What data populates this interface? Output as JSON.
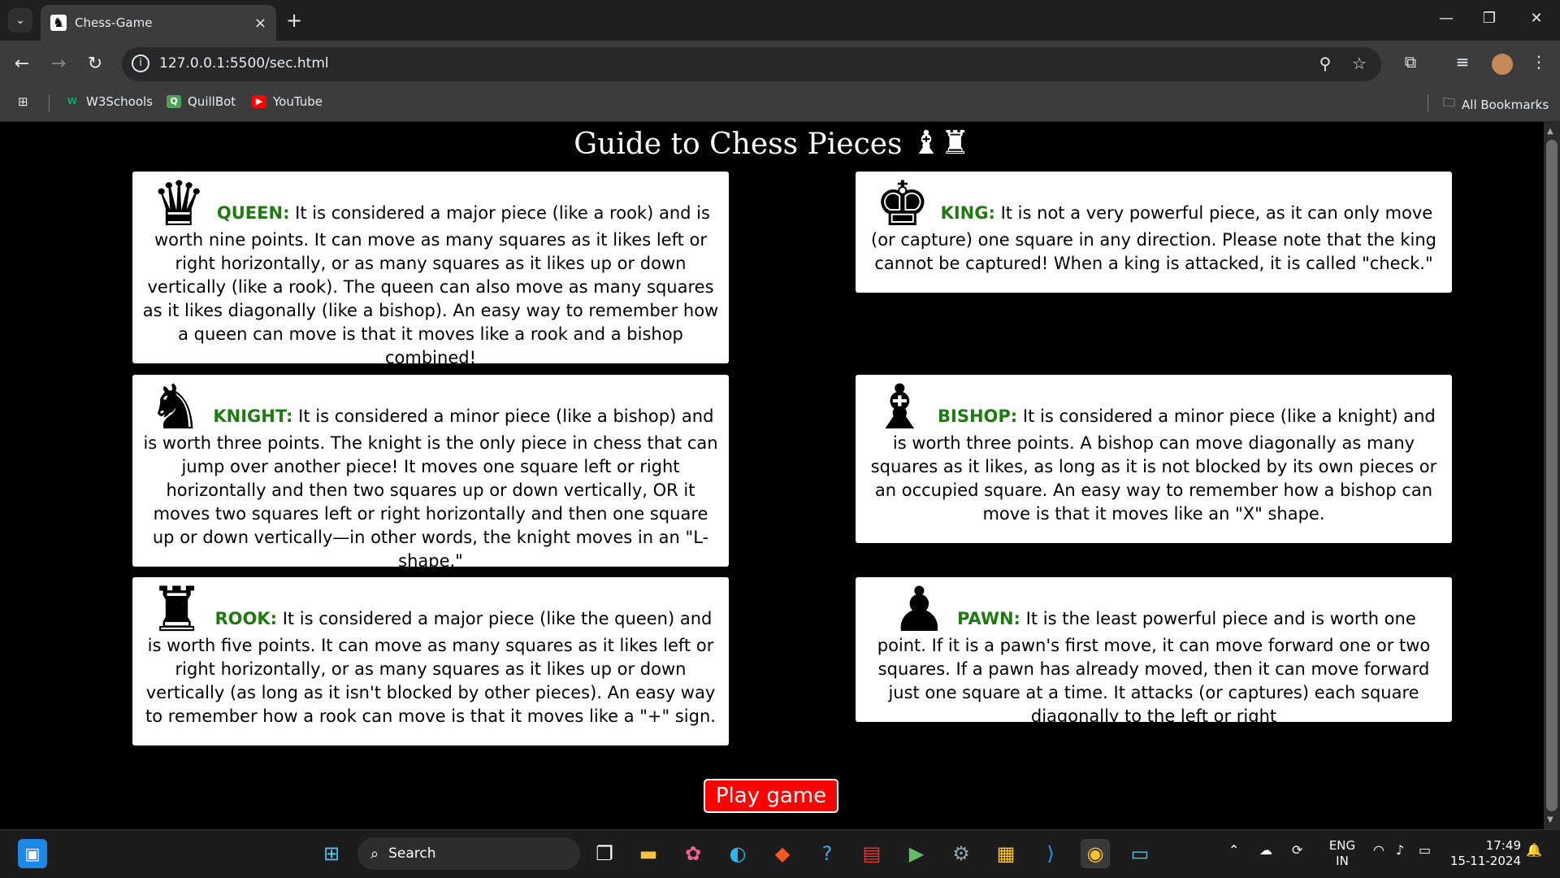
{
  "browser": {
    "tab_title": "Chess-Game",
    "url": "127.0.0.1:5500/sec.html",
    "bookmarks": [
      {
        "label": "W3Schools",
        "icon": "w3schools-icon"
      },
      {
        "label": "QuillBot",
        "icon": "quillbot-icon"
      },
      {
        "label": "YouTube",
        "icon": "youtube-icon"
      }
    ],
    "all_bookmarks": "All Bookmarks"
  },
  "page": {
    "title": "Guide to Chess Pieces",
    "title_glyphs": "♝♜",
    "cards": {
      "queen": {
        "glyph": "♛",
        "name": "QUEEN:",
        "text": "It is considered a major piece (like a rook) and is worth nine points. It can move as many squares as it likes left or right horizontally, or as many squares as it likes up or down vertically (like a rook). The queen can also move as many squares as it likes diagonally (like a bishop). An easy way to remember how a queen can move is that it moves like a rook and a bishop combined!"
      },
      "king": {
        "glyph": "♚",
        "name": "KING:",
        "text": "It is not a very powerful piece, as it can only move (or capture) one square in any direction. Please note that the king cannot be captured! When a king is attacked, it is called \"check.\""
      },
      "knight": {
        "glyph": "♞",
        "name": "KNIGHT:",
        "text": "It is considered a minor piece (like a bishop) and is worth three points. The knight is the only piece in chess that can jump over another piece! It moves one square left or right horizontally and then two squares up or down vertically, OR it moves two squares left or right horizontally and then one square up or down vertically—in other words, the knight moves in an \"L-shape.\""
      },
      "bishop": {
        "glyph": "♝",
        "name": "BISHOP:",
        "text": "It is considered a minor piece (like a knight) and is worth three points. A bishop can move diagonally as many squares as it likes, as long as it is not blocked by its own pieces or an occupied square. An easy way to remember how a bishop can move is that it moves like an \"X\" shape."
      },
      "rook": {
        "glyph": "♜",
        "name": "ROOK:",
        "text": "It is considered a major piece (like the queen) and is worth five points. It can move as many squares as it likes left or right horizontally, or as many squares as it likes up or down vertically (as long as it isn't blocked by other pieces). An easy way to remember how a rook can move is that it moves like a \"+\" sign."
      },
      "pawn": {
        "glyph": "♟",
        "name": "PAWN:",
        "text": "It is the least powerful piece and is worth one point. If it is a pawn's first move, it can move forward one or two squares. If a pawn has already moved, then it can move forward just one square at a time. It attacks (or captures) each square diagonally to the left or right"
      }
    },
    "play_button": "Play game"
  },
  "taskbar": {
    "search_placeholder": "Search",
    "language": "ENG",
    "region": "IN",
    "time": "17:49",
    "date": "15-11-2024"
  },
  "colors": {
    "piece_name": "#1f7a14",
    "play_button": "#ff0000",
    "page_bg": "#000000"
  }
}
